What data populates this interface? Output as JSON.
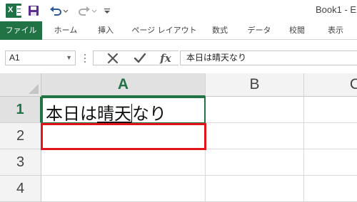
{
  "titlebar": {
    "logo_letter": "X",
    "title": "Book1 - E"
  },
  "ribbon": {
    "tabs": [
      {
        "label": "ファイル",
        "active": true
      },
      {
        "label": "ホーム"
      },
      {
        "label": "挿入"
      },
      {
        "label": "ページ レイアウト"
      },
      {
        "label": "数式"
      },
      {
        "label": "データ"
      },
      {
        "label": "校閲"
      },
      {
        "label": "表示"
      }
    ]
  },
  "formula_bar": {
    "name_box": "A1",
    "fx_label": "fx",
    "content": "本日は晴天なり"
  },
  "grid": {
    "columns": [
      "A",
      "B",
      "C"
    ],
    "rows": [
      "1",
      "2",
      "3",
      "4"
    ],
    "cells": {
      "A1_before": "本日は",
      "A1_composing": "晴天",
      "A1_after": "なり"
    }
  },
  "colors": {
    "accent": "#217346",
    "highlight": "#e0141a"
  }
}
